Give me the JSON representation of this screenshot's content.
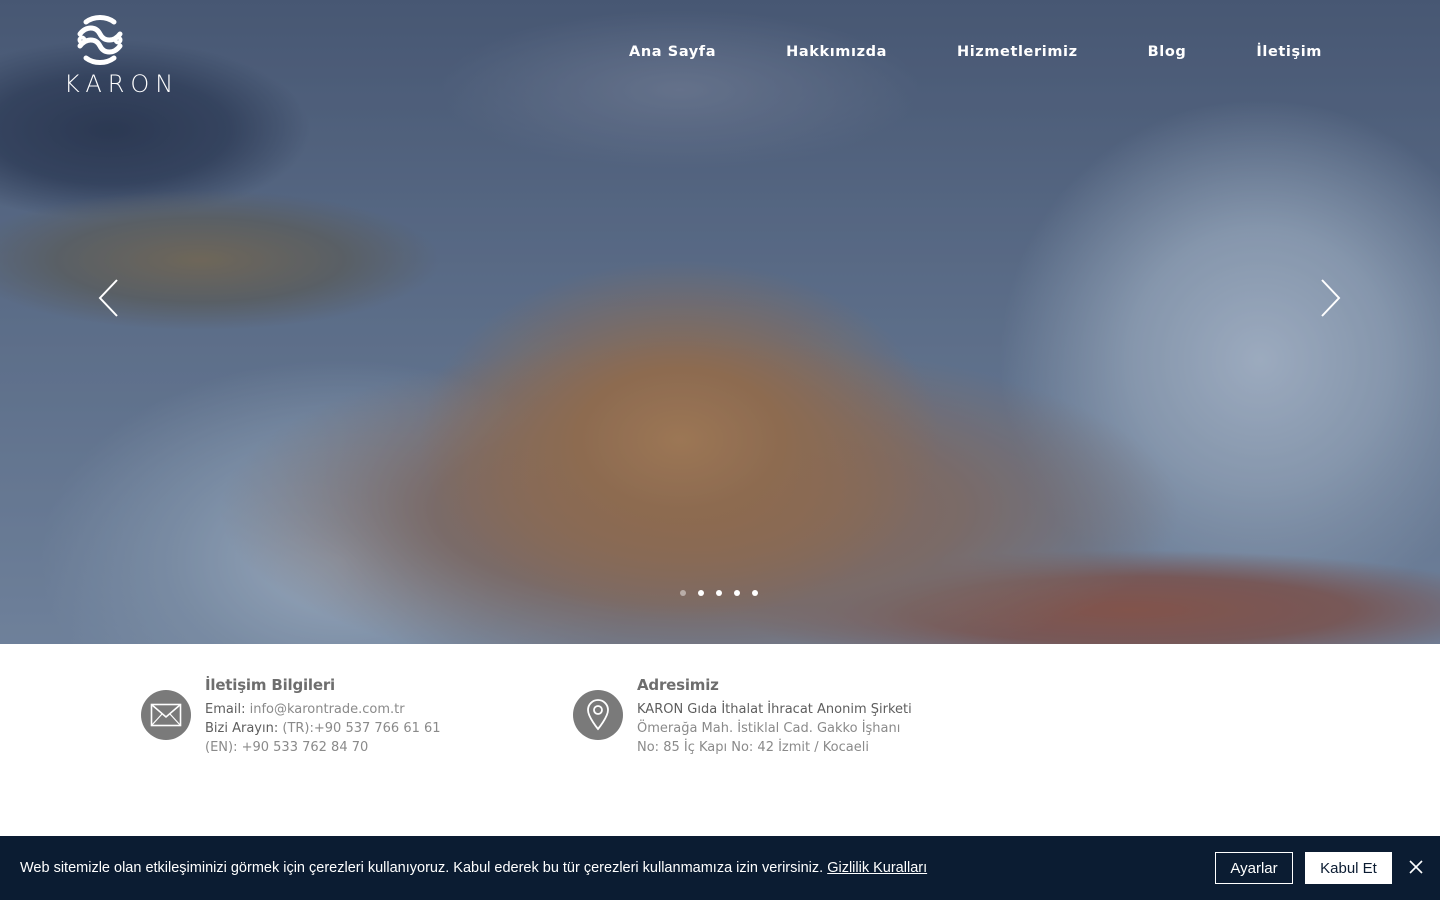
{
  "brand": {
    "name": "KARON"
  },
  "nav": {
    "items": [
      {
        "label": "Ana Sayfa"
      },
      {
        "label": "Hakkımızda"
      },
      {
        "label": "Hizmetlerimiz"
      },
      {
        "label": "Blog"
      },
      {
        "label": "İletişim"
      }
    ]
  },
  "slider": {
    "slide_count": 5,
    "active_index": 0,
    "prev_icon": "chevron-left-icon",
    "next_icon": "chevron-right-icon"
  },
  "contact": {
    "info": {
      "icon": "mail-icon",
      "title": "İletişim Bilgileri",
      "email_label": "Email:",
      "email": "info@karontrade.com.tr",
      "phone_label": "Bizi Arayın:",
      "phone_tr": "(TR):+90 537 766 61 61",
      "phone_en": "(EN): +90 533 762 84 70"
    },
    "address": {
      "icon": "location-pin-icon",
      "title": "Adresimiz",
      "company": "KARON Gıda İthalat İhracat Anonim Şirketi",
      "line1": "Ömerağa Mah. İstiklal Cad. Gakko İşhanı",
      "line2": "No: 85 İç Kapı No: 42 İzmit / Kocaeli"
    }
  },
  "cookie": {
    "message": "Web sitemizle olan etkileşiminizi görmek için çerezleri kullanıyoruz. Kabul ederek bu tür çerezleri kullanmamıza izin verirsiniz.",
    "policy_link": "Gizlilik Kuralları",
    "settings_label": "Ayarlar",
    "accept_label": "Kabul Et"
  },
  "colors": {
    "cookie_bg": "#0b1c32",
    "icon_circle": "#7a7a7a",
    "text_gray": "#8a8a8a"
  }
}
